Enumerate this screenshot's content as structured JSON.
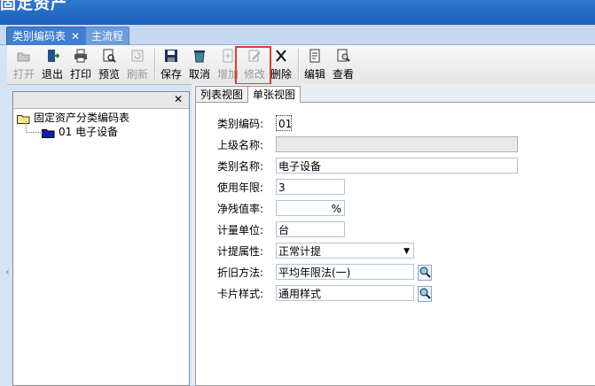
{
  "window": {
    "title": "固定资产"
  },
  "tabs": [
    {
      "label": "类别编码表",
      "close": "✕"
    },
    {
      "label": "主流程"
    }
  ],
  "toolbar": {
    "open": "打开",
    "exit": "退出",
    "print": "打印",
    "preview": "预览",
    "refresh": "刷新",
    "save": "保存",
    "cancel": "取消",
    "add": "增加",
    "modify": "修改",
    "delete": "删除",
    "edit": "编辑",
    "view": "查看"
  },
  "tree": {
    "close": "✕",
    "root": "固定资产分类编码表",
    "child": "01 电子设备"
  },
  "subtabs": {
    "list_view": "列表视图",
    "card_view": "单张视图"
  },
  "form": {
    "code_label": "类别编码:",
    "code_value": "01",
    "parent_label": "上级名称:",
    "parent_value": "",
    "name_label": "类别名称:",
    "name_value": "电子设备",
    "life_label": "使用年限:",
    "life_value": "3",
    "residual_label": "净残值率:",
    "residual_unit": "%",
    "unit_label": "计量单位:",
    "unit_value": "台",
    "attr_label": "计提属性:",
    "attr_value": "正常计提",
    "method_label": "折旧方法:",
    "method_value": "平均年限法(一)",
    "card_label": "卡片样式:",
    "card_value": "通用样式"
  },
  "colors": {
    "accent": "#3f7fd3",
    "highlight": "#e53935"
  }
}
